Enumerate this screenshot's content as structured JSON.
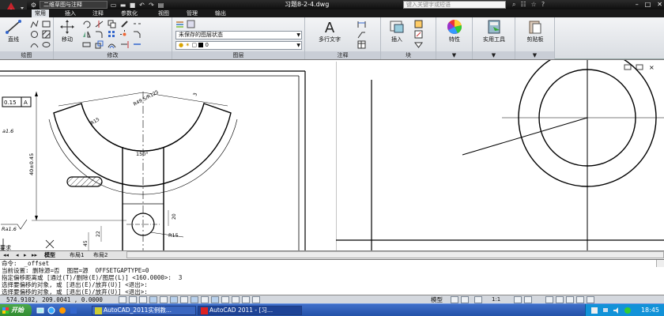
{
  "title_bar": {
    "workspace": "二维草图与注释",
    "document": "习题8-2-4.dwg",
    "search_placeholder": "键入关键字或短语"
  },
  "ribbon_tabs": [
    {
      "label": "常用",
      "active": true
    },
    {
      "label": "插入"
    },
    {
      "label": "注释"
    },
    {
      "label": "参数化"
    },
    {
      "label": "视图"
    },
    {
      "label": "管理"
    },
    {
      "label": "输出"
    }
  ],
  "ribbon": {
    "draw": {
      "panel_label": "绘图",
      "line_label": "直线"
    },
    "modify": {
      "panel_label": "修改",
      "move_label": "移动"
    },
    "layers": {
      "panel_label": "图层",
      "layer_state": "未保存的图层状态",
      "current_layer": "0"
    },
    "annotation": {
      "panel_label": "注释",
      "mtext_label": "多行文字"
    },
    "block": {
      "panel_label": "块",
      "insert_label": "插入"
    },
    "properties": {
      "label": "特性"
    },
    "utilities": {
      "label": "实用工具"
    },
    "clipboard": {
      "label": "剪贴板"
    }
  },
  "drawing": {
    "tolerance": [
      "0.15",
      "A"
    ],
    "roughness_left": "a1.6",
    "roughness_bottom": "Ra1.6",
    "dim_r15_top": "R15",
    "dim_phi_a": "R49.5/R125",
    "dim_angle": "150°",
    "dim_vertical": "40±0.45",
    "dim_3": "3",
    "dim_20": "20",
    "dim_22": "22",
    "dim_45": "45",
    "dim_r15_bottom": "R15",
    "edge_text": "要求"
  },
  "layout_tabs": [
    "模型",
    "布局1",
    "布局2"
  ],
  "command_lines": [
    "命令:  _offset",
    "当前设置: 删除源=否  图层=源  OFFSETGAPTYPE=0",
    "指定偏移距离或 [通过(T)/删除(E)/图层(L)] <160.0000>:  3",
    "选择要偏移的对象, 或 [退出(E)/放弃(U)] <退出>:",
    "选择要偏移的对象, 或 [退出(E)/放弃(U)] <退出>:"
  ],
  "status": {
    "coords": "574.9102, 209.0041 , 0.0000",
    "model": "模型",
    "scale": "1:1"
  },
  "taskbar": {
    "start": "开始",
    "tasks": [
      "AutoCAD_2011实例教...",
      "AutoCAD 2011 - [习..."
    ],
    "clock": "18:45"
  }
}
